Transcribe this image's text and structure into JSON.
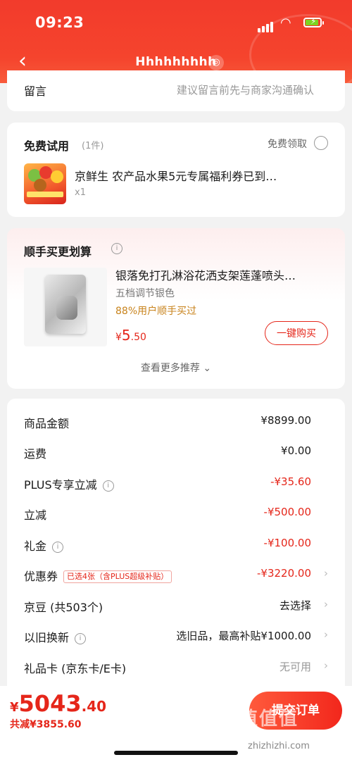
{
  "status_bar": {
    "time": "09:23"
  },
  "nav": {
    "title": "Hhhhhhhhh",
    "back_icon": "‹",
    "location_icon": "◎"
  },
  "remark": {
    "label": "留言",
    "hint": "建议留言前先与商家沟通确认"
  },
  "free_trial": {
    "title": "免费试用",
    "count": "(1件)",
    "claim_label": "免费领取",
    "product_name": "京鲜生 农产品水果5元专属福利券已到…",
    "qty": "x1",
    "thumb_caption": "源头直采周福利"
  },
  "add_on": {
    "title": "顺手买更划算",
    "info_icon": "i",
    "product_name": "银落免打孔淋浴花洒支架莲蓬喷头…",
    "spec": "五档调节银色",
    "rate": "88%用户顺手买过",
    "price_symbol": "¥",
    "price_int": "5",
    "price_dec": ".50",
    "buy_label": "一键购买",
    "more_label": "查看更多推荐 ⌄"
  },
  "summary": {
    "rows": [
      {
        "label": "商品金额",
        "value": "¥8899.00"
      },
      {
        "label": "运费",
        "value": "¥0.00"
      },
      {
        "label": "PLUS专享立减",
        "value": "-¥35.60"
      },
      {
        "label": "立减",
        "value": "-¥500.00"
      },
      {
        "label": "礼金",
        "value": "-¥100.00"
      },
      {
        "label": "优惠券",
        "tag": "已选4张（含PLUS超级补贴）",
        "value": "-¥3220.00"
      },
      {
        "label": "京豆 (共503个)",
        "value": "去选择"
      },
      {
        "label": "以旧换新",
        "value": "选旧品，最高补贴¥1000.00"
      },
      {
        "label": "礼品卡 (京东卡/E卡)",
        "value": "无可用"
      }
    ]
  },
  "footer": {
    "total_symbol": "¥",
    "total_int": "5043",
    "total_dec": ".40",
    "saved": "共减¥3855.60",
    "submit_label": "提交订单"
  },
  "watermark": {
    "text": "值值值",
    "url": "zhizhizhi.com"
  },
  "colors": {
    "brand_red": "#e5261a",
    "header_red": "#f23b2c",
    "gold": "#c8831c"
  }
}
